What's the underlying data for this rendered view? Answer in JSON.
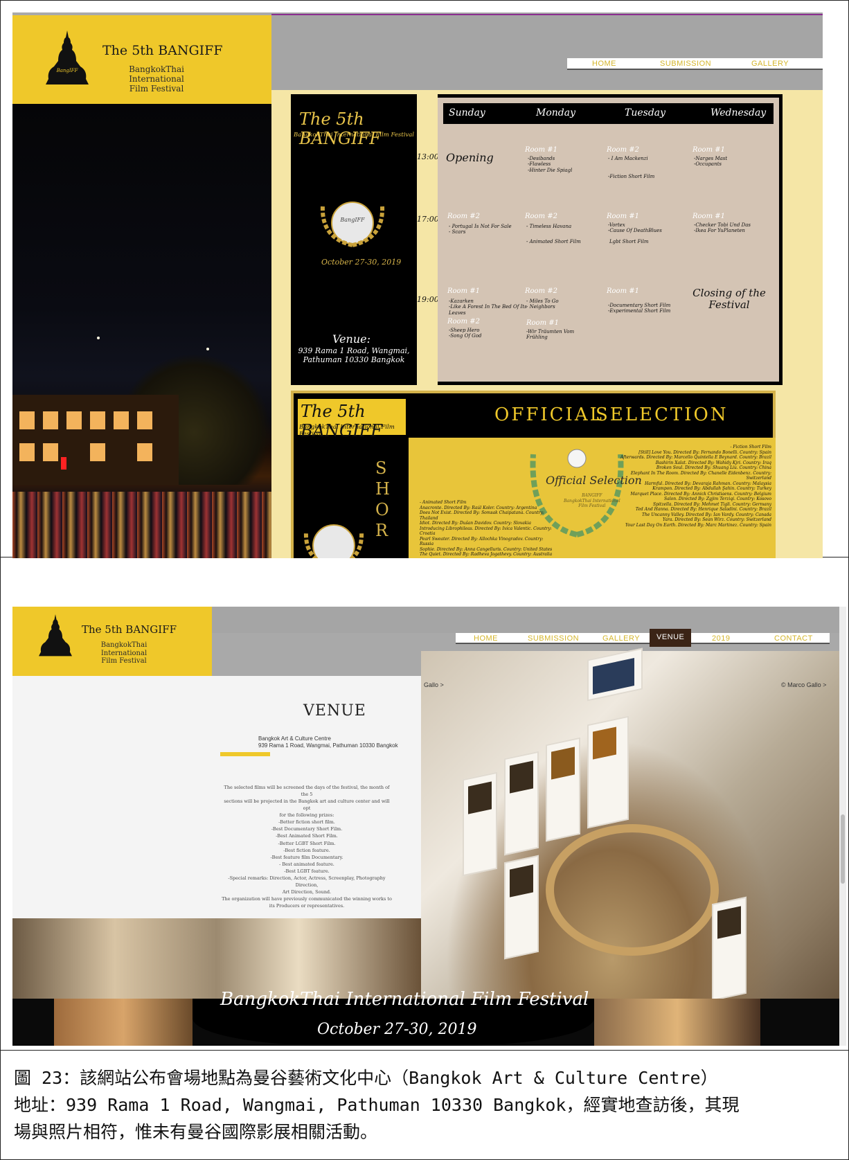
{
  "top": {
    "logo_title": "The 5th BANGIFF",
    "logo_sub_line1": "BangkokThai International",
    "logo_sub_line2": "Film Festival",
    "buddha_badge": "BangIFF",
    "nav": [
      "HOME",
      "SUBMISSION",
      "GALLERY"
    ],
    "poster": {
      "title": "The 5th BANGIFF",
      "subtitle": "BangkokThai International Film Festival",
      "seal_text": "BangIFF",
      "date": "October 27-30, 2019",
      "venue_label": "Venue:",
      "venue_line1": "939 Rama 1 Road, Wangmai,",
      "venue_line2": "Pathuman 10330 Bangkok",
      "days": [
        "Sunday",
        "Monday",
        "Tuesday",
        "Wednesday"
      ],
      "times": [
        "13:00",
        "17:00",
        "19:00"
      ],
      "opening": "Opening",
      "closing_line1": "Closing of the",
      "closing_line2": "Festival",
      "cells": {
        "r1_mon_room": "Room #1",
        "r1_mon_films": [
          "-Desibands",
          "-Flawless",
          "-Hinter Die Spiagl"
        ],
        "r1_tue_room": "Room #2",
        "r1_tue_films": [
          "- I Am Mackenzi"
        ],
        "r1_tue_note": "-Fiction Short Film",
        "r1_wed_room": "Room #1",
        "r1_wed_films": [
          "-Narges Mast",
          "-Occupants"
        ],
        "r2_sun_room": "Room #2",
        "r2_sun_films": [
          "- Portugal Is Not For Sale",
          "- Scars"
        ],
        "r2_mon_room": "Room #2",
        "r2_mon_films": [
          "- Timeless Havana"
        ],
        "r2_mon_note": "- Animated Short Film",
        "r2_tue_room": "Room #1",
        "r2_tue_films": [
          "-Vortex",
          "-Cause Of DeathBlues"
        ],
        "r2_tue_note": "Lgbt Short Film",
        "r2_wed_room": "Room #1",
        "r2_wed_films": [
          "-Checker Tobi Und Das",
          "-Ikea For YuPlaneten"
        ],
        "r3_sun_room": "Room #1",
        "r3_sun_films": [
          "-Kazarken",
          "-Like A Forest In The Bed Of Its",
          "Leaves"
        ],
        "r3_sun_room2": "Room #2",
        "r3_sun_films2": [
          "-Sheep Hero",
          "-Song Of God"
        ],
        "r3_mon_room": "Room #2",
        "r3_mon_films": [
          "- Miles To Go",
          "- Neighbors"
        ],
        "r3_mon_room2": "Room #1",
        "r3_mon_films2": [
          "-Wir Träumten Vom",
          "Frühling"
        ],
        "r3_tue_room": "Room #1",
        "r3_tue_films": [
          "-Documentary Short Film",
          "-Experimental Short Film"
        ]
      }
    },
    "poster2": {
      "title": "The 5th BANGIFF",
      "subtitle": "BangkokThai International Film Festival",
      "official": "OFFICIAL",
      "selection": "SELECTION",
      "short_letters": [
        "S",
        "H",
        "O",
        "R"
      ],
      "seal": "Official Selection",
      "seal_sub1": "BANGIFF",
      "seal_sub2": "BangkokThai International",
      "seal_sub3": "Film Festival",
      "left_col": [
        "- Animated Short Film",
        "Anacronte. Directed By: Raúl Koler. Country: Argentina",
        "Does Not Exist. Directed By: Somsak Chaipatana. Country: Thailand",
        "Idiot. Directed By: Dušan Davidov. Country: Slovakia",
        "Introducing Librophileas. Directed By: Ivica Valentic. Country: Croatia",
        "Pearl Sweater. Directed By: Allochka Vinogradov. Country: Russia",
        "Sophie. Directed By: Anna Cangelluris. Country: United States",
        "The Quiet. Directed By: Radheva Jogathevy. Country: Australia"
      ],
      "right_col": [
        "- Fiction Short Film",
        "[Still] Love You. Directed By: Fernando Bonelli. Country: Spain",
        "Afterwards. Directed By: Marcello Quintella E Beynard. Country: Brazil",
        "Bashirin Xalat. Directed By: Wahidy Kjri. Country: Iraq",
        "Broken Soul. Directed By: Shuang Liu. Country: China",
        "Elephant In The Room. Directed By: Chanelle Eidenbenz. Country: Switzerland",
        "Harmful. Directed By: Devaraja Rahman. Country: Malaysia",
        "Krampon. Directed By: Abdullah Şahin. Country: Turkey",
        "Marquet Place. Directed By: Annick Christiaens. Country: Belgium",
        "Salon. Directed By: Zgjim Terziqi. Country: Kosovo",
        "Spitzella. Directed By: Mehmet Tigli. Country: Germany",
        "Ted And Hanna. Directed By: Henrique Saladini. Country: Brazil",
        "The Uncanny Valley. Directed By: Ian Vardy. Country: Canada",
        "Yara. Directed By: Sean Wirz. Country: Switzerland",
        "Your Last Day On Earth. Directed By: Marc Martinez. Country: Spain"
      ]
    }
  },
  "bottom": {
    "logo_title": "The 5th BANGIFF",
    "logo_sub_line1": "BangkokThai International",
    "logo_sub_line2": "Film Festival",
    "nav": [
      "HOME",
      "SUBMISSION",
      "GALLERY",
      "VENUE",
      "2019",
      "CONTACT"
    ],
    "nav_active": "VENUE",
    "venue_heading": "VENUE",
    "addr_line1": "Bangkok Art & Culture Centre",
    "addr_line2": "939 Rama 1 Road, Wangmai, Pathuman 10330 Bangkok",
    "body_lines": [
      "The selected films will be screened the days of the festival, the month of the 5",
      "sections will be projected in the Bangkok art and culture center and will opt",
      "for the following prizes:",
      "-Better fiction short film.",
      "-Best Documentary Short Film.",
      "-Best Animated Short Film.",
      "-Better LGBT Short Film.",
      "-Best fiction feature.",
      "-Best feature film Documentary.",
      "- Best animated feature.",
      "-Best LGBT feature.",
      "-Special remarks: Direction, Actor, Actress, Screenplay, Photography Direction,",
      "Art Direction, Sound.",
      "The organization will have previously communicated the winning works to",
      "its Producers or representatives."
    ],
    "credit_left": "Gallo >",
    "credit_right": "© Marco Gallo >",
    "banner_title": "BangkokThai International Film Festival",
    "banner_date": "October 27-30, 2019"
  },
  "caption": {
    "line1": "圖 23：該網站公布會場地點為曼谷藝術文化中心（Bangkok Art & Culture Centre）",
    "line2": "地址：939 Rama 1 Road, Wangmai, Pathuman 10330 Bangkok，經實地查訪後，其現",
    "line3": "場與照片相符，惟未有曼谷國際影展相關活動。"
  }
}
